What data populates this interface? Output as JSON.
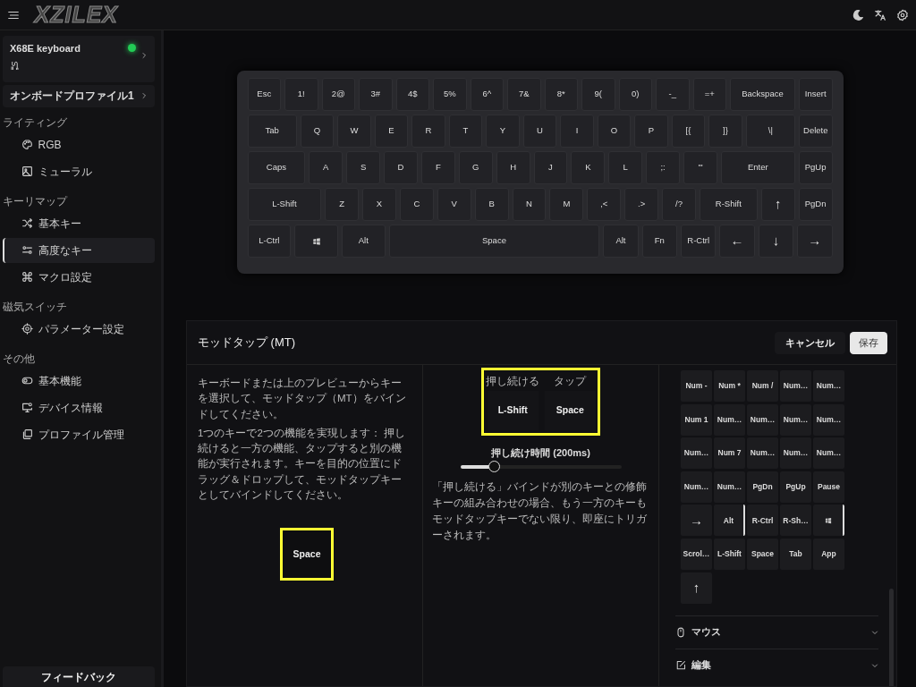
{
  "topbar": {
    "logo": "XZILEX"
  },
  "sidebar": {
    "device": {
      "name": "X68E keyboard",
      "connected": true
    },
    "profile": "オンボードプロファイル1",
    "sections": [
      {
        "title": "ライティング",
        "items": [
          {
            "label": "RGB",
            "selected": false
          },
          {
            "label": "ミューラル",
            "selected": false
          }
        ]
      },
      {
        "title": "キーリマップ",
        "items": [
          {
            "label": "基本キー",
            "selected": false
          },
          {
            "label": "高度なキー",
            "selected": true
          },
          {
            "label": "マクロ設定",
            "selected": false
          }
        ]
      },
      {
        "title": "磁気スイッチ",
        "items": [
          {
            "label": "パラメーター設定",
            "selected": false
          }
        ]
      },
      {
        "title": "その他",
        "items": [
          {
            "label": "基本機能",
            "selected": false
          },
          {
            "label": "デバイス情報",
            "selected": false
          },
          {
            "label": "プロファイル管理",
            "selected": false
          }
        ]
      }
    ],
    "feedback": "フィードバック"
  },
  "keyboard": {
    "rows": [
      {
        "keys": [
          {
            "label": "Esc"
          },
          {
            "label": "1!"
          },
          {
            "label": "2@"
          },
          {
            "label": "3#"
          },
          {
            "label": "4$"
          },
          {
            "label": "5%"
          },
          {
            "label": "6^"
          },
          {
            "label": "7&"
          },
          {
            "label": "8*"
          },
          {
            "label": "9("
          },
          {
            "label": "0)"
          },
          {
            "label": "-_"
          },
          {
            "label": "=+"
          },
          {
            "label": "Backspace"
          },
          {
            "label": "Insert"
          }
        ]
      },
      {
        "keys": [
          {
            "label": "Tab"
          },
          {
            "label": "Q"
          },
          {
            "label": "W"
          },
          {
            "label": "E"
          },
          {
            "label": "R"
          },
          {
            "label": "T"
          },
          {
            "label": "Y"
          },
          {
            "label": "U"
          },
          {
            "label": "I"
          },
          {
            "label": "O"
          },
          {
            "label": "P"
          },
          {
            "label": "[{"
          },
          {
            "label": "]}"
          },
          {
            "label": "\\|"
          },
          {
            "label": "Delete"
          }
        ]
      },
      {
        "keys": [
          {
            "label": "Caps"
          },
          {
            "label": "A"
          },
          {
            "label": "S"
          },
          {
            "label": "D"
          },
          {
            "label": "F"
          },
          {
            "label": "G"
          },
          {
            "label": "H"
          },
          {
            "label": "J"
          },
          {
            "label": "K"
          },
          {
            "label": "L"
          },
          {
            "label": ";:"
          },
          {
            "label": "'\""
          },
          {
            "label": "Enter"
          },
          {
            "label": "PgUp"
          }
        ]
      },
      {
        "keys": [
          {
            "label": "L-Shift"
          },
          {
            "label": "Z"
          },
          {
            "label": "X"
          },
          {
            "label": "C"
          },
          {
            "label": "V"
          },
          {
            "label": "B"
          },
          {
            "label": "N"
          },
          {
            "label": "M"
          },
          {
            "label": ",<"
          },
          {
            "label": ".>"
          },
          {
            "label": "/?"
          },
          {
            "label": "R-Shift"
          },
          {
            "label": "↑"
          },
          {
            "label": "PgDn"
          }
        ]
      },
      {
        "keys": [
          {
            "label": "L-Ctrl"
          },
          {
            "kind": "windows"
          },
          {
            "label": "Alt"
          },
          {
            "label": "Space"
          },
          {
            "label": "Alt"
          },
          {
            "label": "Fn"
          },
          {
            "label": "R-Ctrl"
          },
          {
            "label": "←"
          },
          {
            "label": "↓"
          },
          {
            "label": "→"
          }
        ]
      }
    ]
  },
  "panel": {
    "title": "モッドタップ (MT)",
    "buttons": [
      {
        "label": "キャンセル",
        "kind": "secondary"
      },
      {
        "label": "保存",
        "kind": "primary"
      }
    ],
    "instructions": [
      "キーボードまたは上のプレビューからキーを選択して、モッドタップ（MT）をバインドしてください。",
      "1つのキーで2つの機能を実現します： 押し続けると一方の機能、タップすると別の機能が実行されます。キーを目的の位置にドラッグ＆ドロップして、モッドタップキーとしてバインドしてください。"
    ],
    "selected_key": {
      "label": "Space",
      "highlighted": true
    },
    "binding": {
      "highlighted": true,
      "slots": [
        {
          "caption": "押し続ける",
          "key": "L-Shift"
        },
        {
          "caption": "タップ",
          "key": "Space"
        }
      ]
    },
    "hold_time": {
      "label": "押し続け時間 (200ms)",
      "level": 0.21
    },
    "note": "「押し続ける」バインドが別のキーとの修飾キーの組み合わせの場合、もう一方のキーもモッドタップキーでない限り、即座にトリガーされます。",
    "key_grid": [
      {
        "label": "Num -",
        "marked": false
      },
      {
        "label": "Num *",
        "marked": false
      },
      {
        "label": "Num /",
        "marked": false
      },
      {
        "label": "Num…",
        "marked": false
      },
      {
        "label": "Num…",
        "marked": false
      },
      {
        "label": "Num 1",
        "marked": false
      },
      {
        "label": "Num…",
        "marked": false
      },
      {
        "label": "Num…",
        "marked": false
      },
      {
        "label": "Num…",
        "marked": false
      },
      {
        "label": "Num…",
        "marked": false
      },
      {
        "label": "Num…",
        "marked": false
      },
      {
        "label": "Num 7",
        "marked": false
      },
      {
        "label": "Num…",
        "marked": false
      },
      {
        "label": "Num…",
        "marked": false
      },
      {
        "label": "Num…",
        "marked": false
      },
      {
        "label": "Num…",
        "marked": false
      },
      {
        "label": "Num…",
        "marked": false
      },
      {
        "label": "PgDn",
        "marked": false
      },
      {
        "label": "PgUp",
        "marked": false
      },
      {
        "label": "Pause",
        "marked": false
      },
      {
        "label": "→",
        "marked": false
      },
      {
        "label": "Alt",
        "marked": true
      },
      {
        "label": "R-Ctrl",
        "marked": false
      },
      {
        "label": "R-Sh…",
        "marked": false
      },
      {
        "kind": "windows",
        "marked": true
      },
      {
        "label": "Scrol…",
        "marked": false
      },
      {
        "label": "L-Shift",
        "marked": false
      },
      {
        "label": "Space",
        "marked": false
      },
      {
        "label": "Tab",
        "marked": false
      },
      {
        "label": "App",
        "marked": false
      },
      {
        "label": "↑",
        "marked": false
      }
    ],
    "accordions": [
      {
        "label": "マウス",
        "expanded": false
      },
      {
        "label": "編集",
        "expanded": false
      }
    ]
  }
}
